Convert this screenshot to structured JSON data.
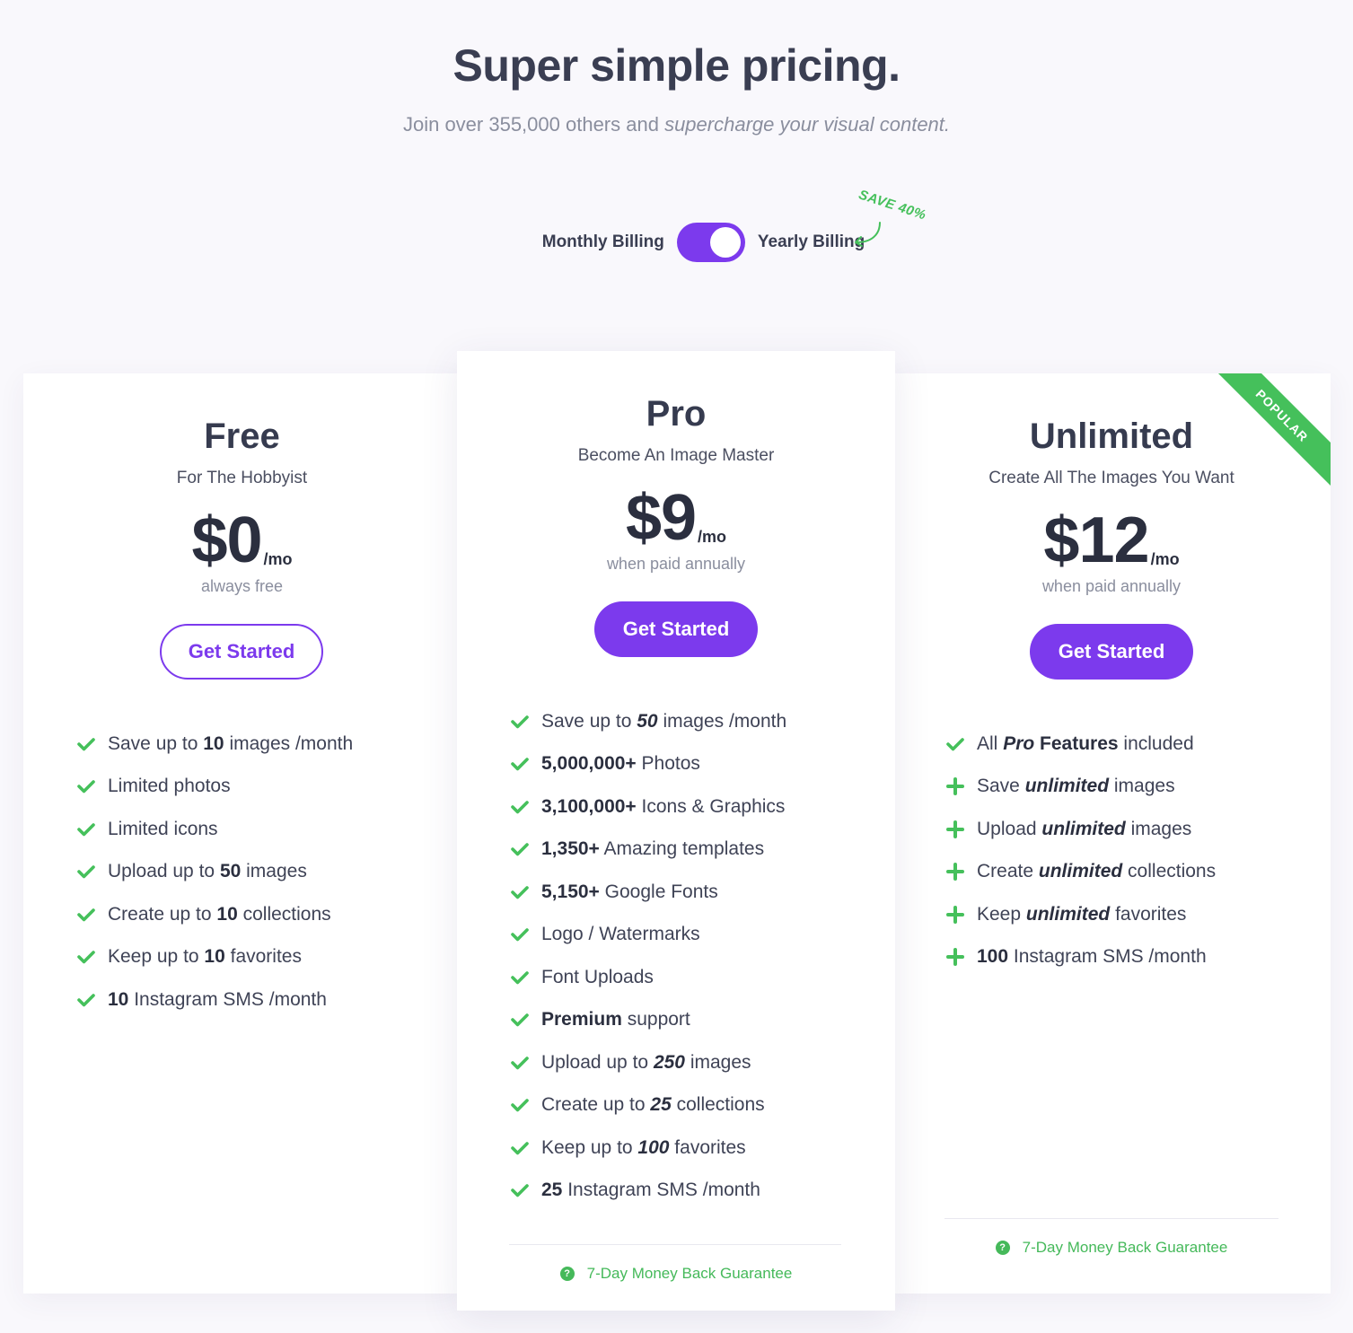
{
  "header": {
    "title": "Super simple pricing.",
    "subtitle_plain": "Join over 355,000 others and ",
    "subtitle_emphasis": "supercharge your visual content."
  },
  "billing": {
    "monthly_label": "Monthly Billing",
    "yearly_label": "Yearly Billing",
    "save_badge": "SAVE 40%",
    "yearly_selected": true
  },
  "colors": {
    "accent": "#7c3aed",
    "success": "#45c05b",
    "background": "#f9f8fc"
  },
  "plans": {
    "free": {
      "name": "Free",
      "tagline": "For The Hobbyist",
      "price": "$0",
      "per": "/mo",
      "note": "always free",
      "cta": "Get Started"
    },
    "pro": {
      "name": "Pro",
      "tagline": "Become An Image Master",
      "price": "$9",
      "per": "/mo",
      "note": "when paid annually",
      "cta": "Get Started",
      "guarantee": "7-Day Money Back Guarantee"
    },
    "unlimited": {
      "name": "Unlimited",
      "tagline": "Create All The Images You Want",
      "price": "$12",
      "per": "/mo",
      "note": "when paid annually",
      "cta": "Get Started",
      "ribbon": "POPULAR",
      "guarantee": "7-Day Money Back Guarantee"
    }
  },
  "features": {
    "free": [
      {
        "icon": "check-icon",
        "parts": [
          {
            "t": "Save up to "
          },
          {
            "t": "10",
            "s": "b"
          },
          {
            "t": " images /month"
          }
        ]
      },
      {
        "icon": "check-icon",
        "parts": [
          {
            "t": "Limited photos"
          }
        ]
      },
      {
        "icon": "check-icon",
        "parts": [
          {
            "t": "Limited icons"
          }
        ]
      },
      {
        "icon": "check-icon",
        "parts": [
          {
            "t": "Upload up to "
          },
          {
            "t": "50",
            "s": "b"
          },
          {
            "t": " images"
          }
        ]
      },
      {
        "icon": "check-icon",
        "parts": [
          {
            "t": "Create up to "
          },
          {
            "t": "10",
            "s": "b"
          },
          {
            "t": " collections"
          }
        ]
      },
      {
        "icon": "check-icon",
        "parts": [
          {
            "t": "Keep up to "
          },
          {
            "t": "10",
            "s": "b"
          },
          {
            "t": " favorites"
          }
        ]
      },
      {
        "icon": "check-icon",
        "parts": [
          {
            "t": "10",
            "s": "b"
          },
          {
            "t": " Instagram SMS /month"
          }
        ]
      }
    ],
    "pro": [
      {
        "icon": "check-icon",
        "parts": [
          {
            "t": "Save up to "
          },
          {
            "t": "50",
            "s": "i"
          },
          {
            "t": " images /month"
          }
        ]
      },
      {
        "icon": "check-icon",
        "parts": [
          {
            "t": "5,000,000+",
            "s": "b"
          },
          {
            "t": " Photos"
          }
        ]
      },
      {
        "icon": "check-icon",
        "parts": [
          {
            "t": "3,100,000+",
            "s": "b"
          },
          {
            "t": " Icons & Graphics"
          }
        ]
      },
      {
        "icon": "check-icon",
        "parts": [
          {
            "t": "1,350+",
            "s": "b"
          },
          {
            "t": " Amazing templates"
          }
        ]
      },
      {
        "icon": "check-icon",
        "parts": [
          {
            "t": "5,150+",
            "s": "b"
          },
          {
            "t": " Google Fonts"
          }
        ]
      },
      {
        "icon": "check-icon",
        "parts": [
          {
            "t": "Logo / Watermarks"
          }
        ]
      },
      {
        "icon": "check-icon",
        "parts": [
          {
            "t": "Font Uploads"
          }
        ]
      },
      {
        "icon": "check-icon",
        "parts": [
          {
            "t": "Premium",
            "s": "b"
          },
          {
            "t": " support"
          }
        ]
      },
      {
        "icon": "check-icon",
        "parts": [
          {
            "t": "Upload up to "
          },
          {
            "t": "250",
            "s": "i"
          },
          {
            "t": " images"
          }
        ]
      },
      {
        "icon": "check-icon",
        "parts": [
          {
            "t": "Create up to "
          },
          {
            "t": "25",
            "s": "i"
          },
          {
            "t": " collections"
          }
        ]
      },
      {
        "icon": "check-icon",
        "parts": [
          {
            "t": "Keep up to "
          },
          {
            "t": "100",
            "s": "i"
          },
          {
            "t": " favorites"
          }
        ]
      },
      {
        "icon": "check-icon",
        "parts": [
          {
            "t": "25",
            "s": "b"
          },
          {
            "t": " Instagram SMS /month"
          }
        ]
      }
    ],
    "unlimited": [
      {
        "icon": "check-icon",
        "parts": [
          {
            "t": "All "
          },
          {
            "t": "Pro",
            "s": "i"
          },
          {
            "t": " Features",
            "s": "b"
          },
          {
            "t": " included"
          }
        ]
      },
      {
        "icon": "plus-icon",
        "parts": [
          {
            "t": "Save "
          },
          {
            "t": "unlimited",
            "s": "i"
          },
          {
            "t": " images"
          }
        ]
      },
      {
        "icon": "plus-icon",
        "parts": [
          {
            "t": "Upload "
          },
          {
            "t": "unlimited",
            "s": "i"
          },
          {
            "t": " images"
          }
        ]
      },
      {
        "icon": "plus-icon",
        "parts": [
          {
            "t": "Create "
          },
          {
            "t": "unlimited",
            "s": "i"
          },
          {
            "t": " collections"
          }
        ]
      },
      {
        "icon": "plus-icon",
        "parts": [
          {
            "t": "Keep "
          },
          {
            "t": "unlimited",
            "s": "i"
          },
          {
            "t": " favorites"
          }
        ]
      },
      {
        "icon": "plus-icon",
        "parts": [
          {
            "t": "100",
            "s": "b"
          },
          {
            "t": " Instagram SMS /month"
          }
        ]
      }
    ]
  }
}
